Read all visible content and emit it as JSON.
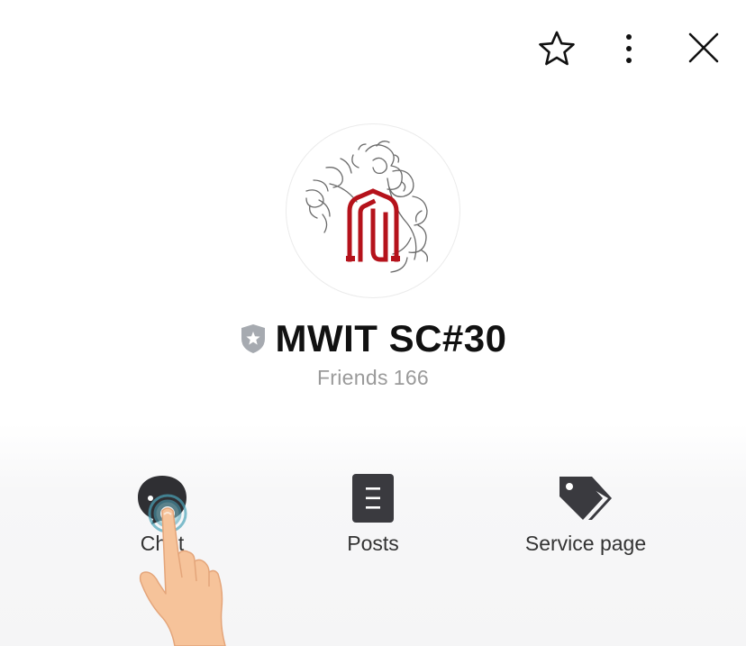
{
  "header": {
    "star_icon": "star-outline-icon",
    "more_icon": "more-vertical-icon",
    "close_icon": "close-icon"
  },
  "profile": {
    "name": "MWIT SC#30",
    "verified_badge_icon": "shield-star-icon",
    "friends_label": "Friends",
    "friends_count": "166",
    "avatar_icon": "mwit-floral-logo"
  },
  "actions": [
    {
      "label": "Chat",
      "icon": "chat-bubble-icon"
    },
    {
      "label": "Posts",
      "icon": "document-icon"
    },
    {
      "label": "Service page",
      "icon": "tags-icon"
    }
  ],
  "colors": {
    "brand_red": "#b5121b",
    "icon_dark": "#3a3a3f",
    "muted_text": "#9a9a9a",
    "tap_indicator": "#4aa3b8"
  },
  "overlay": {
    "tap_hand_icon": "tap-hand-pointer-icon"
  }
}
